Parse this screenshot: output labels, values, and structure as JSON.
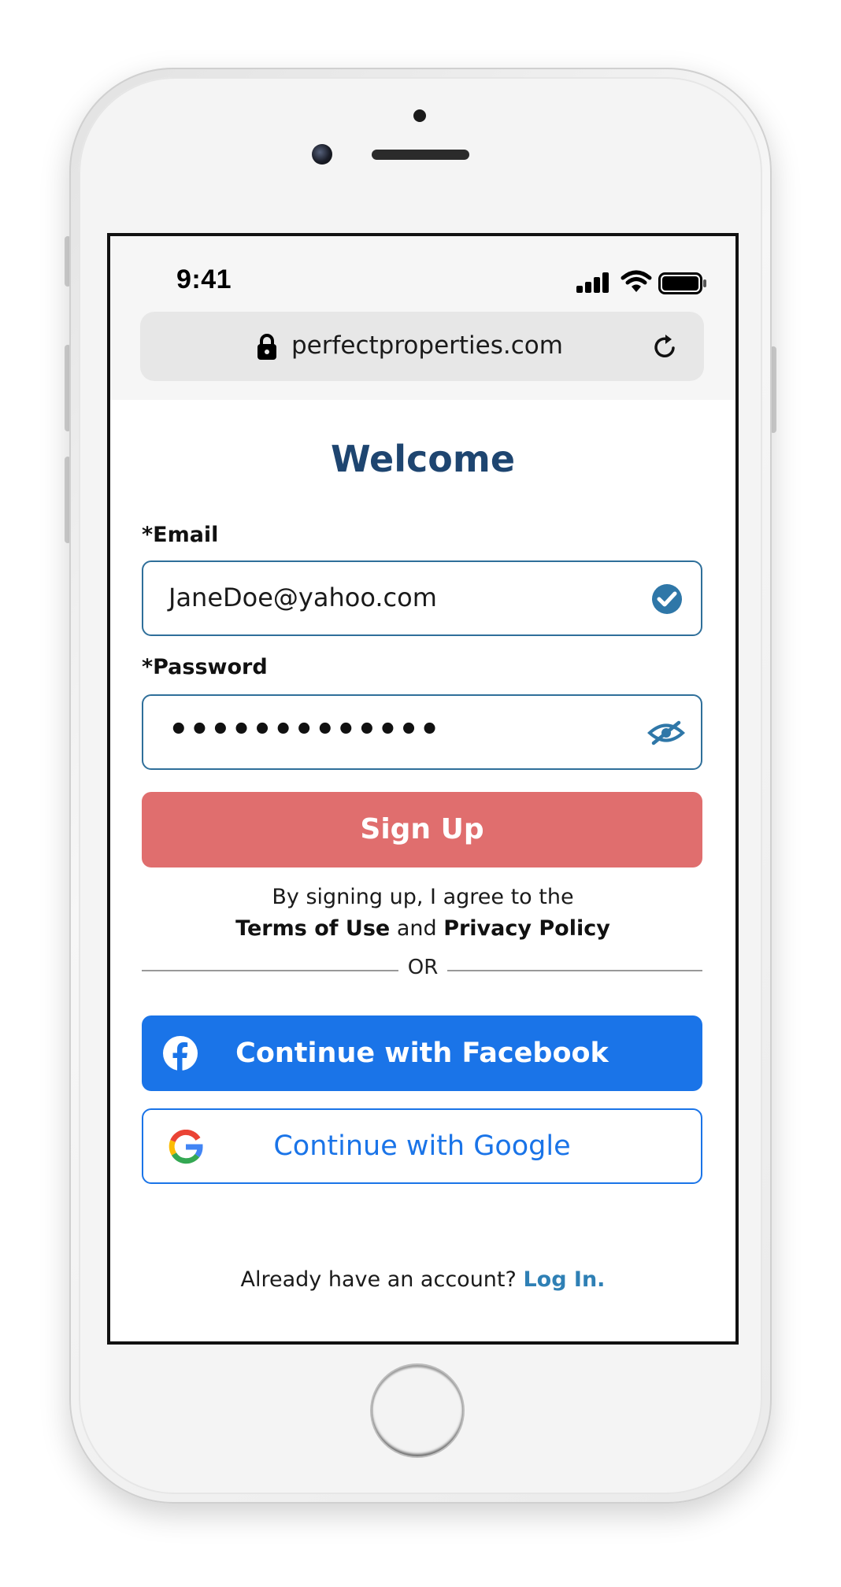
{
  "status_bar": {
    "time": "9:41"
  },
  "browser": {
    "url": "perfectproperties.com",
    "icons": [
      "lock-icon",
      "reload-icon"
    ]
  },
  "form": {
    "title": "Welcome",
    "email": {
      "label": "*Email",
      "value": "JaneDoe@yahoo.com",
      "status_icon": "check-circle-icon"
    },
    "password": {
      "label": "*Password",
      "value_masked": "•••••••••••••",
      "toggle_icon": "eye-slash-icon"
    },
    "signup_label": "Sign Up",
    "legal": {
      "intro": "By signing up, I agree to the",
      "terms": "Terms of Use",
      "conjunction": "and",
      "privacy": "Privacy Policy"
    },
    "divider_text": "OR",
    "facebook_label": "Continue with Facebook",
    "google_label": "Continue with Google",
    "login_prompt": "Already have an account?",
    "login_link": "Log In."
  },
  "colors": {
    "title": "#1e4570",
    "accent_blue": "#2f6f9a",
    "signup": "#e06e6e",
    "facebook": "#1a74e8",
    "google_text": "#1a74e8",
    "login_link": "#2f80b5"
  }
}
